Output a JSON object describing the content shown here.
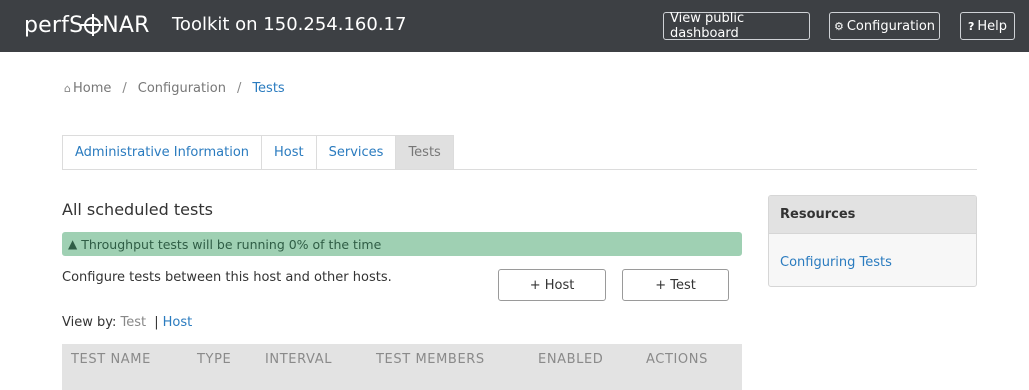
{
  "header": {
    "logo_left": "perfS",
    "logo_right": "NAR",
    "title": "Toolkit on 150.254.160.17",
    "buttons": {
      "dashboard": "View public dashboard",
      "configuration": "Configuration",
      "help": "Help"
    },
    "icons": {
      "configuration": "gear-icon",
      "help": "question-icon"
    }
  },
  "breadcrumb": {
    "home": "Home",
    "configuration": "Configuration",
    "tests": "Tests",
    "separator": "/"
  },
  "tabs": [
    {
      "label": "Administrative Information",
      "active": false
    },
    {
      "label": "Host",
      "active": false
    },
    {
      "label": "Services",
      "active": false
    },
    {
      "label": "Tests",
      "active": true
    }
  ],
  "main": {
    "title": "All scheduled tests",
    "alert": "Throughput tests will be running 0% of the time",
    "description": "Configure tests between this host and other hosts.",
    "add_host_label": "+ Host",
    "add_test_label": "+ Test",
    "view_by": {
      "label": "View by:",
      "test": "Test",
      "separator": "|",
      "host": "Host"
    },
    "table_headers": [
      "TEST NAME",
      "TYPE",
      "INTERVAL",
      "TEST MEMBERS",
      "ENABLED",
      "ACTIONS"
    ]
  },
  "resources": {
    "title": "Resources",
    "link": "Configuring Tests"
  },
  "colors": {
    "header_bg": "#3d4044",
    "link": "#2a7bbf",
    "alert_bg": "#9fd0b3"
  }
}
